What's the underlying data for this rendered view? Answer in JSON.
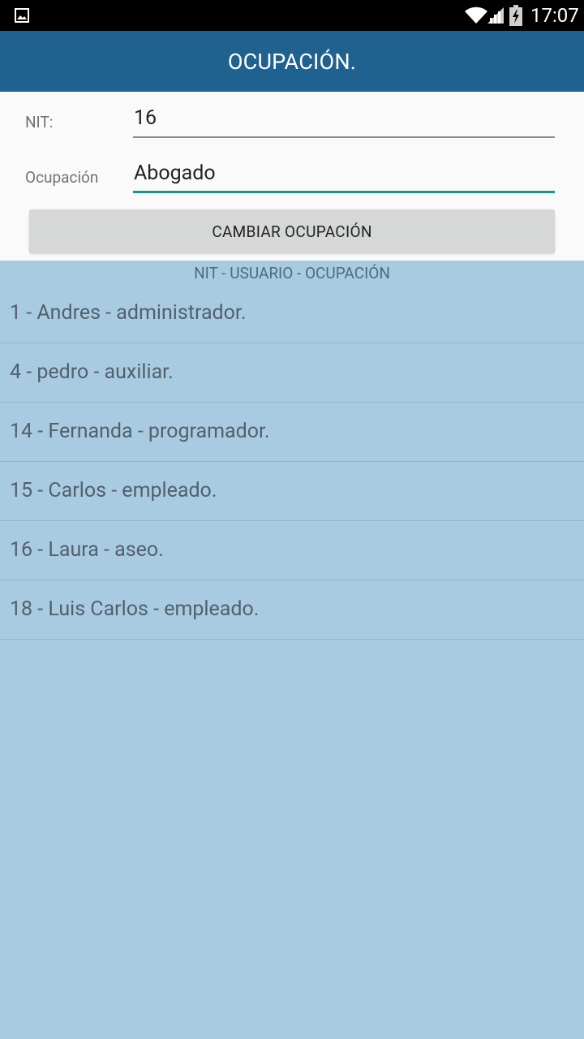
{
  "status_bar": {
    "time": "17:07",
    "icons": [
      "image-notification-icon",
      "wifi-icon",
      "signal-icon",
      "battery-charging-icon"
    ]
  },
  "action_bar": {
    "title": "OCUPACIÓN."
  },
  "form": {
    "nit_label": "NIT:",
    "nit_value": "16",
    "ocupacion_label": "Ocupación",
    "ocupacion_value": "Abogado",
    "button_label": "CAMBIAR OCUPACIÓN"
  },
  "list": {
    "header": "NIT - USUARIO - OCUPACIÓN",
    "items": [
      "1 - Andres - administrador.",
      "4 - pedro - auxiliar.",
      "14 - Fernanda - programador.",
      "15 - Carlos - empleado.",
      "16 - Laura - aseo.",
      "18 - Luis Carlos - empleado."
    ]
  },
  "colors": {
    "action_bar": "#1f618f",
    "list_background": "#a9cbe1",
    "focused_underline": "#17958a",
    "button": "#d6d7d7"
  }
}
